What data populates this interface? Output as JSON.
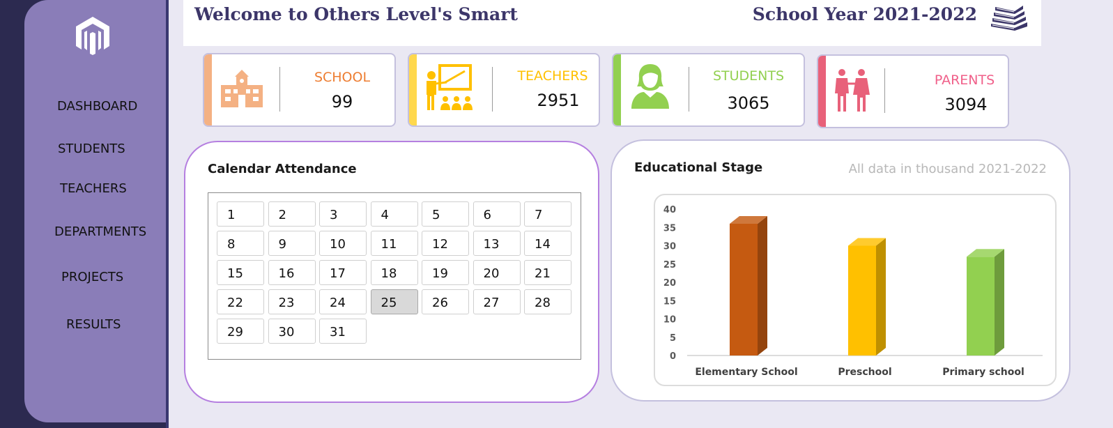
{
  "sidebar": {
    "items": [
      {
        "label": "DASHBOARD"
      },
      {
        "label": "STUDENTS"
      },
      {
        "label": "TEACHERS"
      },
      {
        "label": "DEPARTMENTS"
      },
      {
        "label": "PROJECTS"
      },
      {
        "label": "RESULTS"
      }
    ]
  },
  "header": {
    "title": "Welcome to Others Level's Smart",
    "school_year": "School Year 2021-2022"
  },
  "cards": [
    {
      "label": "SCHOOL",
      "value": "99",
      "color": "#f4b183",
      "label_color": "#ed7d31",
      "icon": "school-building-icon"
    },
    {
      "label": "TEACHERS",
      "value": "2951",
      "color": "#ffd84d",
      "label_color": "#ffc000",
      "icon": "teacher-classroom-icon"
    },
    {
      "label": "STUDENTS",
      "value": "3065",
      "color": "#92d050",
      "label_color": "#92d050",
      "icon": "student-icon"
    },
    {
      "label": "PARENTS",
      "value": "3094",
      "color": "#e8617a",
      "label_color": "#f0608a",
      "icon": "parents-icon"
    }
  ],
  "calendar": {
    "title": "Calendar Attendance",
    "days": [
      "1",
      "2",
      "3",
      "4",
      "5",
      "6",
      "7",
      "8",
      "9",
      "10",
      "11",
      "12",
      "13",
      "14",
      "15",
      "16",
      "17",
      "18",
      "19",
      "20",
      "21",
      "22",
      "23",
      "24",
      "25",
      "26",
      "27",
      "28",
      "29",
      "30",
      "31"
    ],
    "selected_day": "25"
  },
  "stage": {
    "title": "Educational Stage",
    "note": "All data in thousand 2021-2022"
  },
  "chart_data": {
    "type": "bar",
    "categories": [
      "Elementary School",
      "Preschool",
      "Primary school"
    ],
    "values": [
      36,
      30,
      27
    ],
    "colors": [
      "#c55a11",
      "#ffc000",
      "#92d050"
    ],
    "ylim": [
      0,
      40
    ],
    "yticks": [
      "0",
      "5",
      "10",
      "15",
      "20",
      "25",
      "30",
      "35",
      "40"
    ],
    "title": "",
    "xlabel": "",
    "ylabel": "",
    "grid": false,
    "style": "3d-column"
  }
}
